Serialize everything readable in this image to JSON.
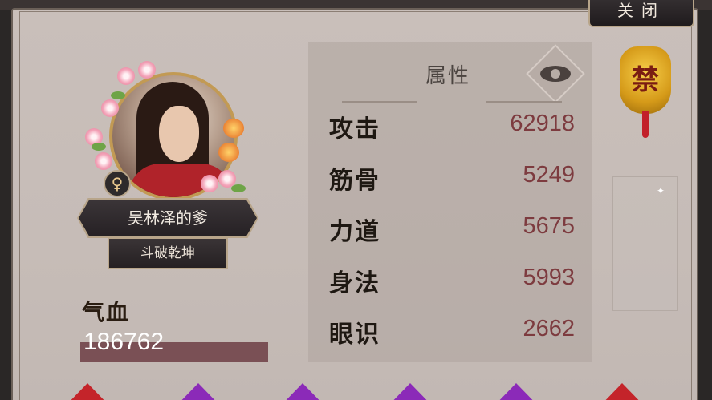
{
  "window": {
    "close_label": "关闭"
  },
  "character": {
    "gender_symbol": "♀",
    "name": "吴林泽的爹",
    "title": "斗破乾坤"
  },
  "health": {
    "label": "气血",
    "value": "186762"
  },
  "stats": {
    "title": "属性",
    "rows": [
      {
        "name": "攻击",
        "value": "62918"
      },
      {
        "name": "筋骨",
        "value": "5249"
      },
      {
        "name": "力道",
        "value": "5675"
      },
      {
        "name": "身法",
        "value": "5993"
      },
      {
        "name": "眼识",
        "value": "2662"
      }
    ]
  },
  "badge": {
    "label": "禁"
  },
  "colors": {
    "stat_value": "#7d3b3f",
    "hp_bar": "#7a5055",
    "gem_red": "#c4242a",
    "gem_purple": "#8b2ab8"
  },
  "icons": {
    "visibility": "eye-icon",
    "sparkle": "sparkle-icon"
  }
}
